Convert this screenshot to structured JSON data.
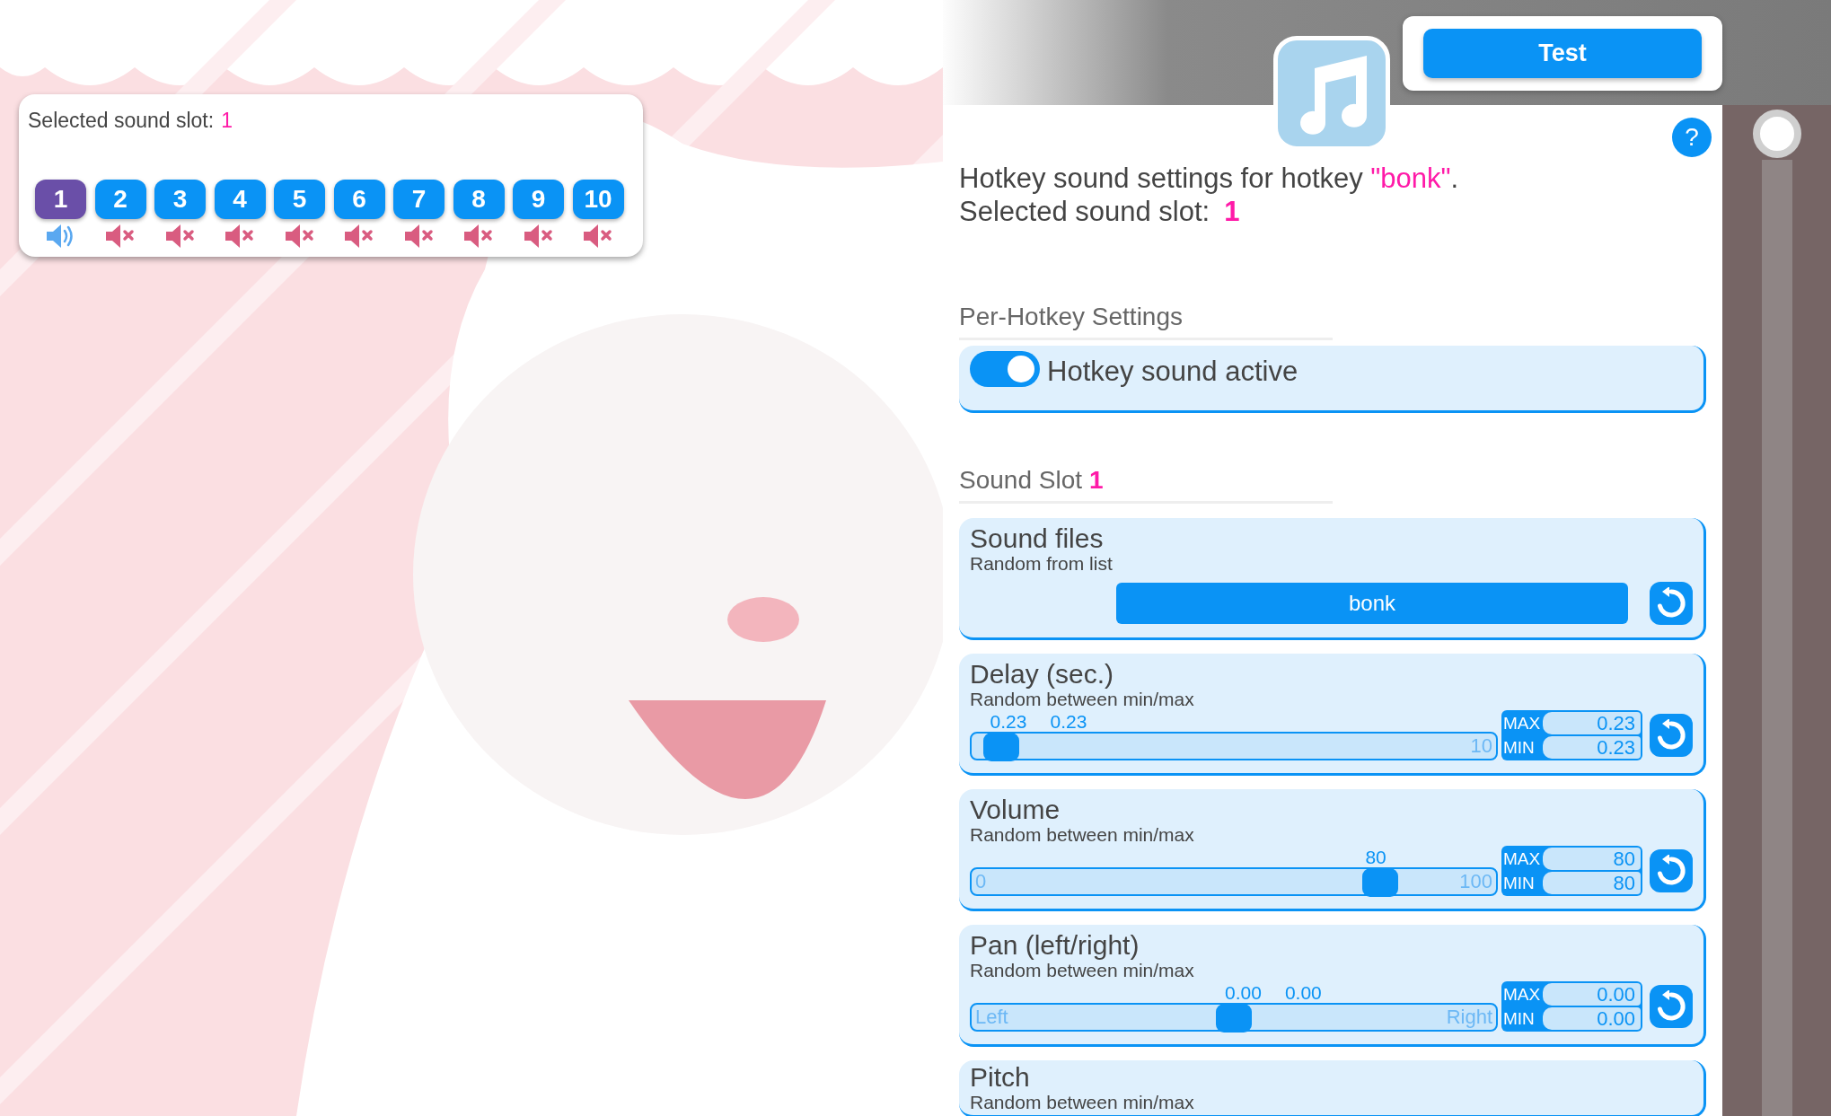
{
  "slot_panel": {
    "label": "Selected sound slot:",
    "value": "1",
    "slots": [
      {
        "label": "1",
        "selected": true,
        "muted": false
      },
      {
        "label": "2",
        "selected": false,
        "muted": true
      },
      {
        "label": "3",
        "selected": false,
        "muted": true
      },
      {
        "label": "4",
        "selected": false,
        "muted": true
      },
      {
        "label": "5",
        "selected": false,
        "muted": true
      },
      {
        "label": "6",
        "selected": false,
        "muted": true
      },
      {
        "label": "7",
        "selected": false,
        "muted": true
      },
      {
        "label": "8",
        "selected": false,
        "muted": true
      },
      {
        "label": "9",
        "selected": false,
        "muted": true
      },
      {
        "label": "10",
        "selected": false,
        "muted": true
      }
    ]
  },
  "test_button": "Test",
  "help": "?",
  "header": {
    "prefix": "Hotkey sound settings for hotkey ",
    "hotkey": "\"bonk\"",
    "suffix": ".",
    "slot_label": "Selected sound slot:",
    "slot_value": "1"
  },
  "per_hotkey": {
    "title": "Per-Hotkey Settings",
    "toggle": {
      "label": "Hotkey sound active",
      "on": true
    }
  },
  "sound_slot": {
    "title": "Sound Slot",
    "number": "1"
  },
  "sound_files": {
    "title": "Sound files",
    "subtitle": "Random from list",
    "file": "bonk"
  },
  "ranges": [
    {
      "title": "Delay (sec.)",
      "subtitle": "Random between min/max",
      "readings": [
        "0.23",
        "0.23"
      ],
      "level": 0.023,
      "max_label": "10",
      "max_tag": "MAX",
      "max_value": "0.23",
      "min_tag": "MIN",
      "min_value": "0.23"
    },
    {
      "title": "Volume",
      "subtitle": "Random between min/max",
      "readings": [
        "80"
      ],
      "level": 0.8,
      "min_label": "0",
      "max_label": "100",
      "max_tag": "MAX",
      "max_value": "80",
      "min_tag": "MIN",
      "min_value": "80"
    },
    {
      "title": "Pan (left/right)",
      "subtitle": "Random between min/max",
      "readings": [
        "0.00",
        "0.00"
      ],
      "level": 0.5,
      "min_label": "Left",
      "max_label": "Right",
      "max_tag": "MAX",
      "max_value": "0.00",
      "min_tag": "MIN",
      "min_value": "0.00"
    }
  ],
  "pitch": {
    "title": "Pitch",
    "subtitle": "Random between min/max"
  }
}
